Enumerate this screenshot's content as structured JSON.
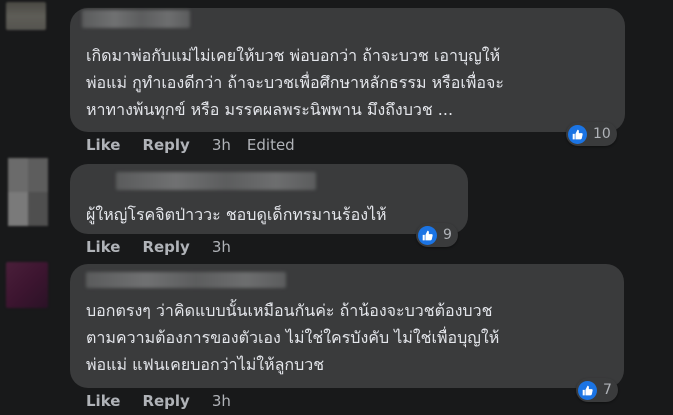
{
  "comments": [
    {
      "text": "เกิดมาพ่อกับแม่ไม่เคยให้บวช พ่อบอกว่า ถ้าจะบวช เอาบุญให้\nพ่อแม่ กูทำเองดีกว่า ถ้าจะบวชเพื่อศึกษาหลักธรรม หรือเพื่อจะ\nหาทางพ้นทุกข์ หรือ มรรคผลพระนิพพาน มึงถึงบวช ...",
      "reaction_count": "10",
      "like_label": "Like",
      "reply_label": "Reply",
      "time": "3h",
      "edited": "Edited"
    },
    {
      "text": "ผู้ใหญ่โรคจิตป่าววะ ชอบดูเด็กทรมานร้องไห้",
      "reaction_count": "9",
      "like_label": "Like",
      "reply_label": "Reply",
      "time": "3h"
    },
    {
      "text": "บอกตรงๆ ว่าคิดแบบนั้นเหมือนกันค่ะ ถ้าน้องจะบวชต้องบวช\nตามความต้องการของตัวเอง ไม่ใช่ใครบังคับ ไม่ใช่เพื่อบุญให้\nพ่อแม่ แฟนเคยบอกว่าไม่ให้ลูกบวช",
      "reaction_count": "7",
      "like_label": "Like",
      "reply_label": "Reply",
      "time": "3h"
    }
  ],
  "colors": {
    "background": "#18191a",
    "bubble": "#3a3b3c",
    "text": "#e4e6eb",
    "secondary": "#b0b3b8",
    "like_blue": "#1b74e4"
  }
}
